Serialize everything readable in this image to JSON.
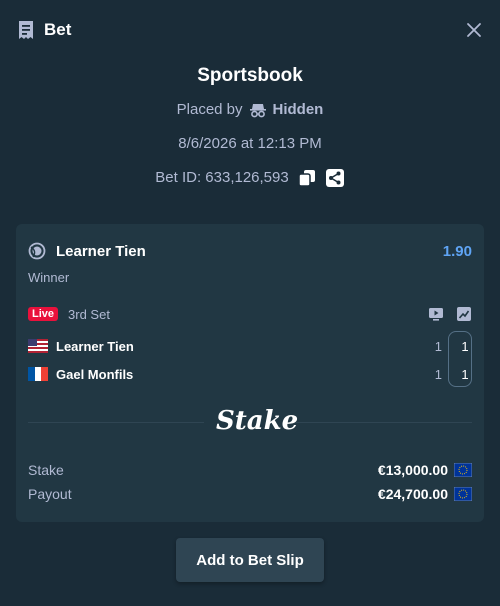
{
  "header": {
    "title": "Bet"
  },
  "summary": {
    "book": "Sportsbook",
    "placed_by_label": "Placed by",
    "placed_by_user": "Hidden",
    "date": "8/6/2026 at 12:13 PM",
    "bet_id": "Bet ID: 633,126,593"
  },
  "selection": {
    "name": "Learner Tien",
    "odds": "1.90",
    "market": "Winner",
    "live_label": "Live",
    "period": "3rd Set",
    "teams": [
      {
        "name": "Learner Tien",
        "set_score": "1",
        "game_score": "1",
        "flag": "us-flag-icon"
      },
      {
        "name": "Gael Monfils",
        "set_score": "1",
        "game_score": "1",
        "flag": "fr-flag-icon"
      }
    ]
  },
  "brand": {
    "logo_text": "Stake"
  },
  "amounts": {
    "stake_label": "Stake",
    "stake_value": "€13,000.00",
    "payout_label": "Payout",
    "payout_value": "€24,700.00",
    "currency_icon": "eur-icon"
  },
  "actions": {
    "add_to_slip": "Add to Bet Slip"
  },
  "colors": {
    "background": "#1a2c38",
    "card": "#213743",
    "accent_odds": "#5fa4f4",
    "live": "#e9113c"
  }
}
